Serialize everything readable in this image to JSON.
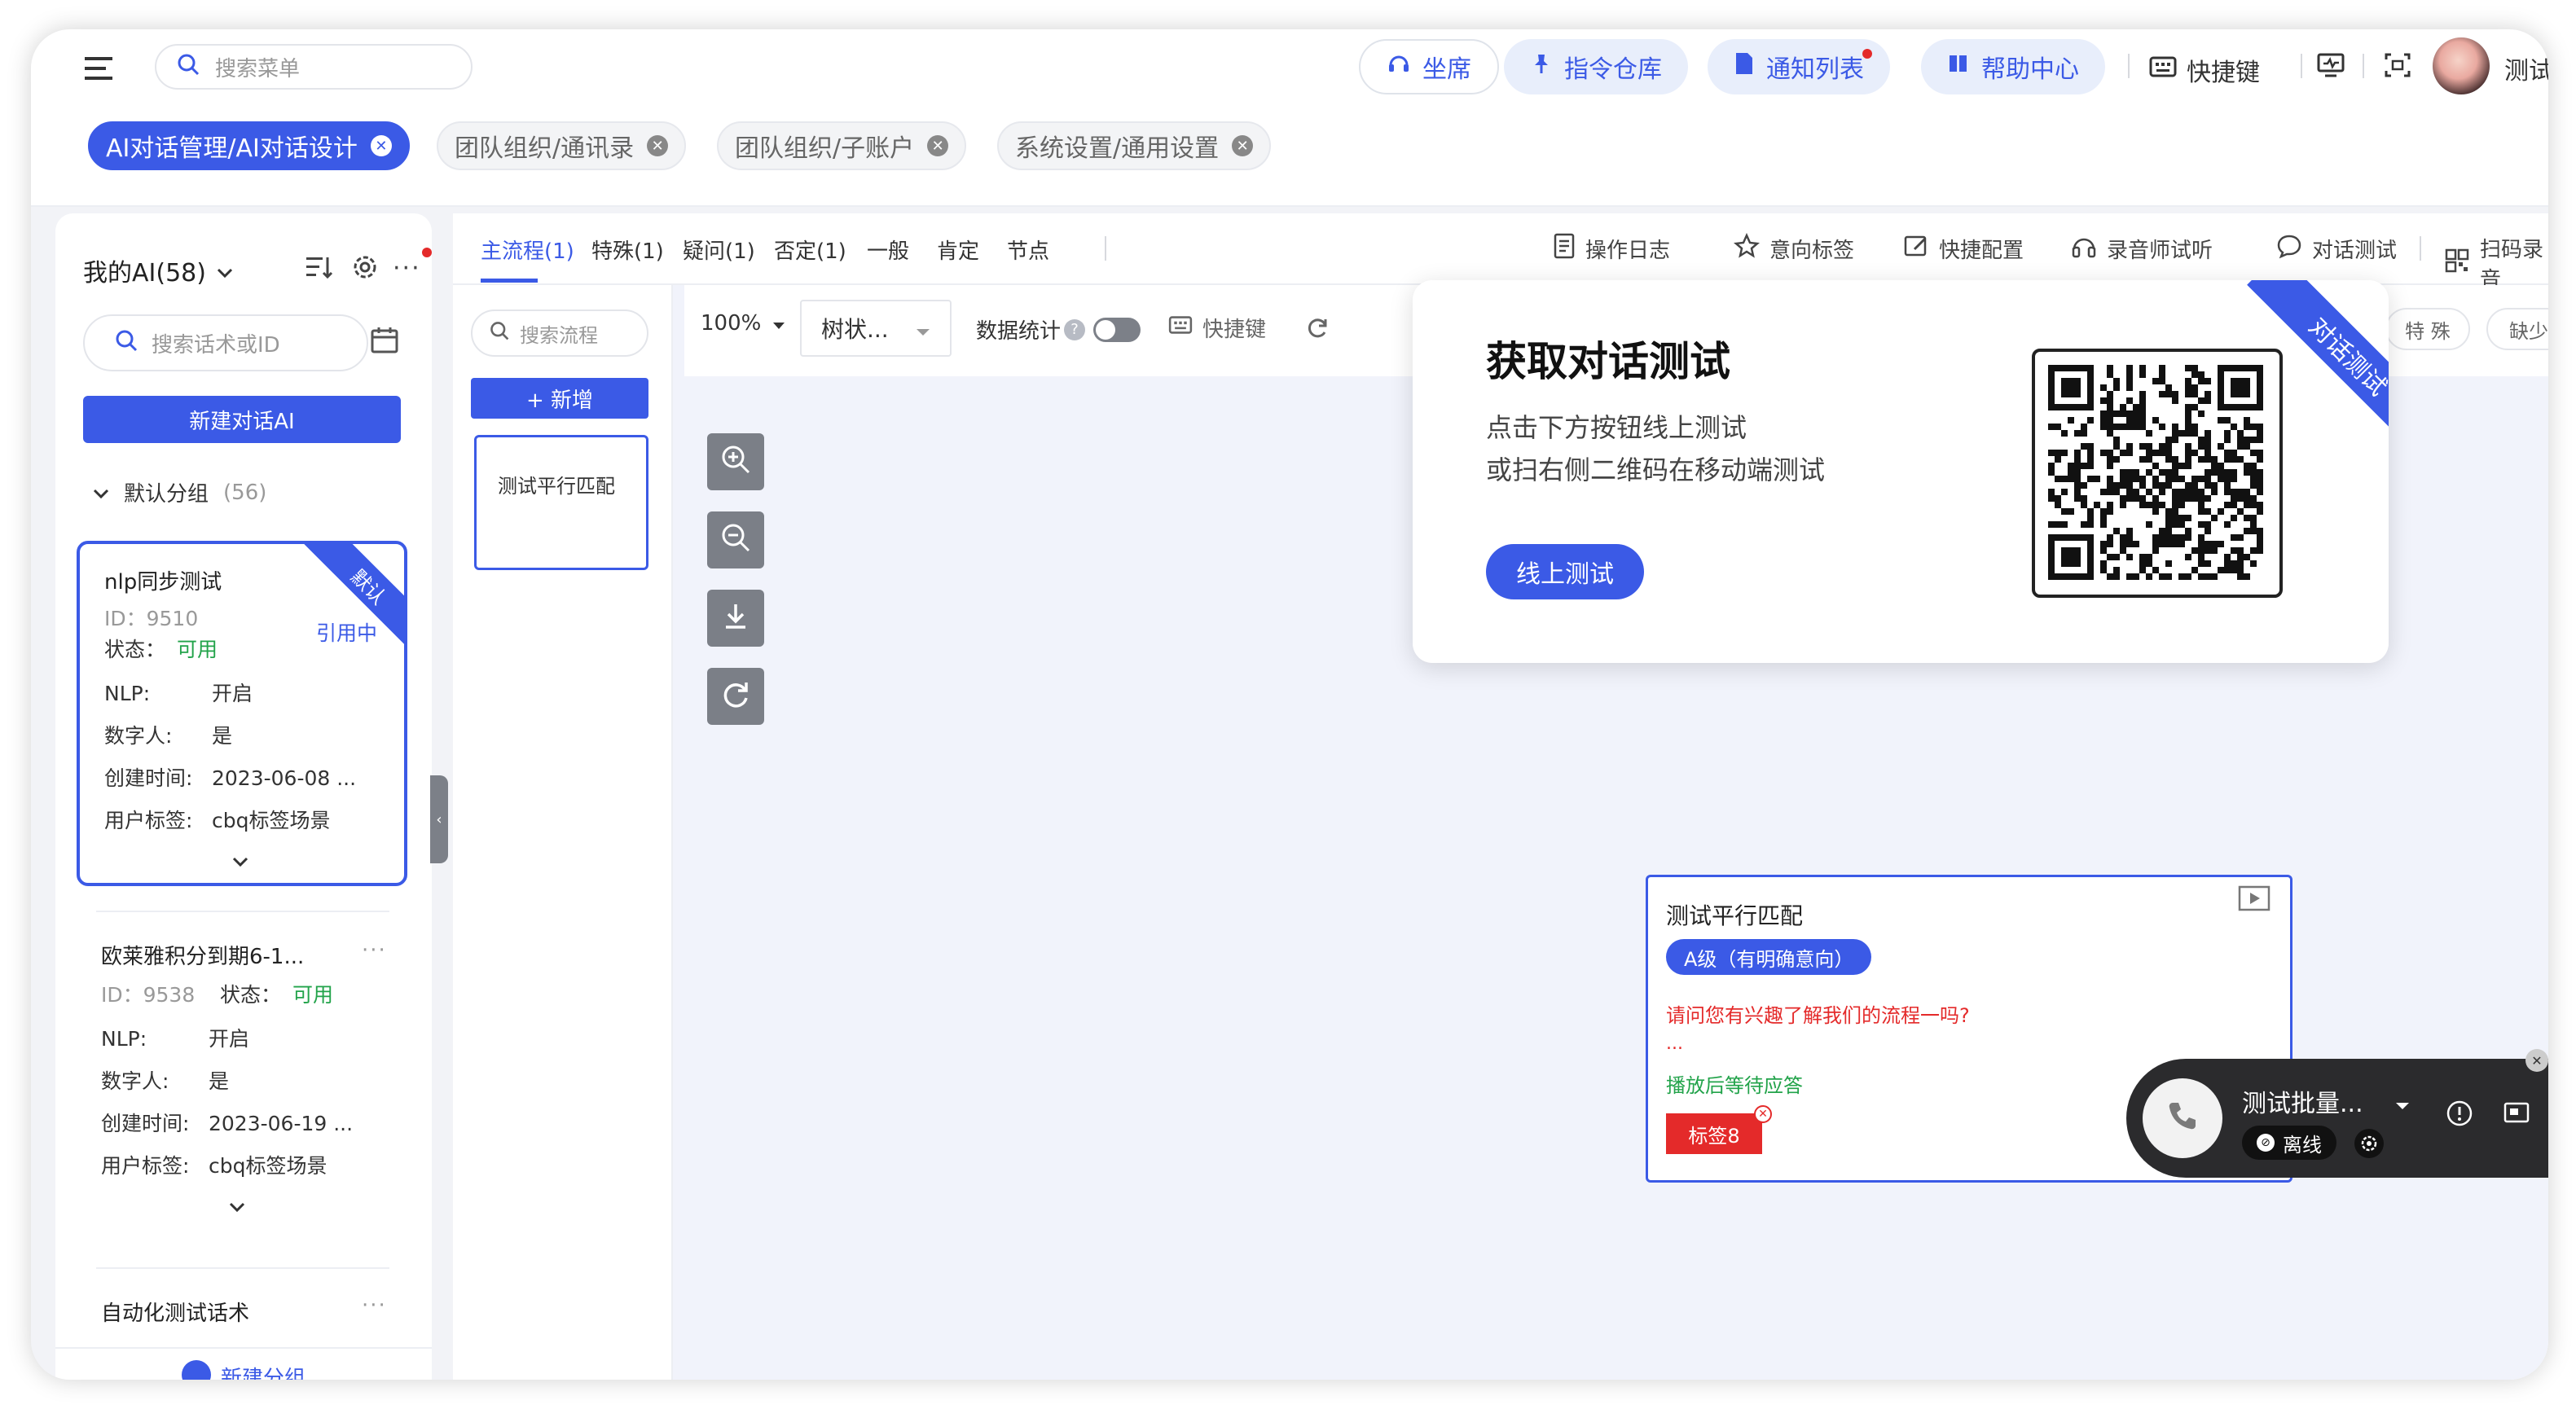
{
  "header": {
    "search_placeholder": "搜索菜单",
    "buttons": [
      {
        "label": "坐席",
        "icon": "headset-icon"
      },
      {
        "label": "指令仓库",
        "icon": "pin-icon"
      },
      {
        "label": "通知列表",
        "icon": "doc-icon"
      },
      {
        "label": "帮助中心",
        "icon": "book-icon"
      }
    ],
    "shortcut_label": "快捷键",
    "user_label": "测试"
  },
  "tabs": [
    {
      "label": "AI对话管理/AI对话设计",
      "active": true
    },
    {
      "label": "团队组织/通讯录",
      "active": false
    },
    {
      "label": "团队组织/子账户",
      "active": false
    },
    {
      "label": "系统设置/通用设置",
      "active": false
    }
  ],
  "sidebar": {
    "title": "我的AI(58)",
    "search_placeholder": "搜索话术或ID",
    "new_button": "新建对话AI",
    "group_label": "默认分组",
    "group_count": "(56)",
    "bottom_action": "新建分组",
    "items": [
      {
        "name": "nlp同步测试",
        "id_label": "ID：",
        "id": "9510",
        "status_label": "状态：",
        "status": "可用",
        "in_use": "引用中",
        "nlp_label": "NLP:",
        "nlp": "开启",
        "digital_label": "数字人:",
        "digital": "是",
        "created_label": "创建时间:",
        "created": "2023-06-08 ...",
        "tags_label": "用户标签:",
        "tags": "cbq标签场景",
        "ribbon": "默认"
      },
      {
        "name": "欧莱雅积分到期6-1...",
        "id_label": "ID：",
        "id": "9538",
        "status_label": "状态：",
        "status": "可用",
        "nlp_label": "NLP:",
        "nlp": "开启",
        "digital_label": "数字人:",
        "digital": "是",
        "created_label": "创建时间:",
        "created": "2023-06-19 ...",
        "tags_label": "用户标签:",
        "tags": "cbq标签场景"
      },
      {
        "name": "自动化测试话术"
      }
    ]
  },
  "flow_tabs": [
    "主流程(1)",
    "特殊(1)",
    "疑问(1)",
    "否定(1)",
    "一般",
    "肯定",
    "节点"
  ],
  "toolbar_right": [
    "操作日志",
    "意向标签",
    "快捷配置",
    "录音师试听",
    "对话测试",
    "扫码录音"
  ],
  "flow_panel": {
    "search_placeholder": "搜索流程",
    "add_button": "+ 新增",
    "flows": [
      "测试平行匹配"
    ]
  },
  "canvas_toolbar": {
    "zoom": "100%",
    "view": "树状...",
    "stats_label": "数据统计",
    "shortcut_label": "快捷键"
  },
  "chips_right": [
    "特 殊",
    "缺少"
  ],
  "popup": {
    "title": "获取对话测试",
    "line1": "点击下方按钮线上测试",
    "line2": "或扫右侧二维码在移动端测试",
    "button": "线上测试",
    "ribbon": "对话测试"
  },
  "node": {
    "title": "测试平行匹配",
    "level": "A级（有明确意向）",
    "question": "请问您有兴趣了解我们的流程一吗?",
    "ellipsis": "...",
    "action": "播放后等待应答",
    "tag": "标签8"
  },
  "call_widget": {
    "title": "测试批量...",
    "status": "离线"
  },
  "colors": {
    "primary": "#3b5ae6",
    "green": "#22a34a",
    "red": "#e42a2a",
    "dark": "#222222"
  }
}
